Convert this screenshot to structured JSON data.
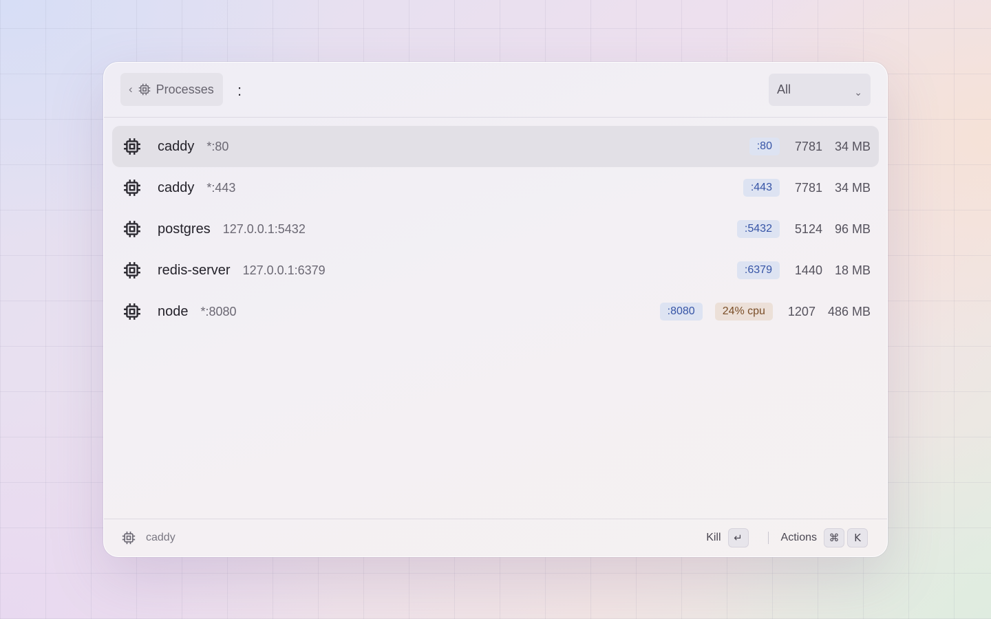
{
  "header": {
    "back_glyph": "‹",
    "breadcrumb_label": "Processes",
    "search_value": ":",
    "filter": {
      "selected": "All",
      "chevron": "⌄"
    }
  },
  "rows": [
    {
      "name": "caddy",
      "address": "*:80",
      "port": ":80",
      "cpu": "",
      "pid": "7781",
      "mem": "34 MB",
      "selected": true
    },
    {
      "name": "caddy",
      "address": "*:443",
      "port": ":443",
      "cpu": "",
      "pid": "7781",
      "mem": "34 MB",
      "selected": false
    },
    {
      "name": "postgres",
      "address": "127.0.0.1:5432",
      "port": ":5432",
      "cpu": "",
      "pid": "5124",
      "mem": "96 MB",
      "selected": false
    },
    {
      "name": "redis-server",
      "address": "127.0.0.1:6379",
      "port": ":6379",
      "cpu": "",
      "pid": "1440",
      "mem": "18 MB",
      "selected": false
    },
    {
      "name": "node",
      "address": "*:8080",
      "port": ":8080",
      "cpu": "24% cpu",
      "pid": "1207",
      "mem": "486 MB",
      "selected": false
    }
  ],
  "footer": {
    "selected_name": "caddy",
    "primary_action": "Kill",
    "primary_key": "↵",
    "secondary_action": "Actions",
    "secondary_keys": [
      "⌘",
      "K"
    ]
  },
  "icons": {
    "row_icon": "cpu-chip-icon",
    "breadcrumb_icon": "cpu-chip-icon",
    "footer_icon": "cpu-chip-icon"
  },
  "colors": {
    "port_badge_bg": "#dde3f2",
    "port_badge_text": "#3654a6",
    "cpu_badge_bg": "#ece0d8",
    "cpu_badge_text": "#7a4e28",
    "selected_row": "#e2e0e6"
  }
}
